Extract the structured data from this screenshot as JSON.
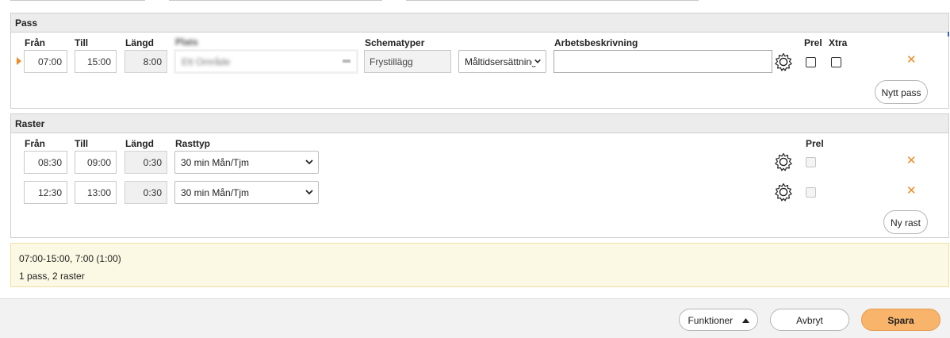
{
  "pass": {
    "title": "Pass",
    "headers": {
      "from": "Från",
      "to": "Till",
      "length": "Längd",
      "blurred": "Plats",
      "schema_types": "Schematyper",
      "work_desc": "Arbetsbeskrivning",
      "prel": "Prel",
      "xtra": "Xtra"
    },
    "row": {
      "from": "07:00",
      "to": "15:00",
      "length": "8:00",
      "blurred_value": "Ett Område",
      "schema_type": "Frystillägg",
      "select_value": "Måltidsersättning",
      "work_desc": ""
    },
    "new_button": "Nytt pass"
  },
  "breaks": {
    "title": "Raster",
    "headers": {
      "from": "Från",
      "to": "Till",
      "length": "Längd",
      "type": "Rasttyp",
      "prel": "Prel"
    },
    "rows": [
      {
        "from": "08:30",
        "to": "09:00",
        "length": "0:30",
        "type": "30 min Mån/Tjm"
      },
      {
        "from": "12:30",
        "to": "13:00",
        "length": "0:30",
        "type": "30 min Mån/Tjm"
      }
    ],
    "new_button": "Ny rast"
  },
  "summary": {
    "line1": "07:00-15:00, 7:00 (1:00)",
    "line2": "1 pass, 2 raster"
  },
  "footer": {
    "functions": "Funktioner",
    "cancel": "Avbryt",
    "save": "Spara"
  },
  "colors": {
    "accent": "#f08a24",
    "save_bg": "#f9b46b",
    "summary_bg": "#fbf8e3"
  },
  "icons": {
    "gear": "gear-icon",
    "remove": "close-icon",
    "chevron": "chevron-down-icon",
    "caret": "caret-up-icon",
    "row_marker": "caret-right-icon"
  }
}
